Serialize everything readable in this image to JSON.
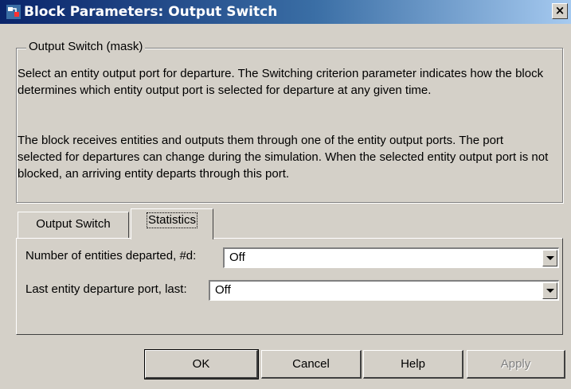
{
  "window": {
    "title": "Block Parameters: Output Switch",
    "close_label": "×"
  },
  "group": {
    "legend": "Output Switch (mask)",
    "paragraphs": [
      "Select an entity output port for departure. The Switching criterion parameter indicates how the block determines which entity output port is selected for departure at any given time.",
      "The block receives entities and outputs them through one of the entity output ports. The port selected for departures can change during the simulation. When the selected entity output port is not blocked, an arriving entity departs through this port."
    ]
  },
  "tabs": [
    {
      "label": "Output Switch",
      "active": false
    },
    {
      "label": "Statistics",
      "active": true
    }
  ],
  "fields": [
    {
      "label": "Number of entities departed, #d:",
      "value": "Off"
    },
    {
      "label": "Last entity departure port, last:",
      "value": "Off"
    }
  ],
  "buttons": {
    "ok": "OK",
    "cancel": "Cancel",
    "help": "Help",
    "apply": "Apply"
  },
  "colors": {
    "title_bar_start": "#0a246a",
    "title_bar_end": "#a6caf0",
    "dialog_bg": "#d4d0c8"
  }
}
